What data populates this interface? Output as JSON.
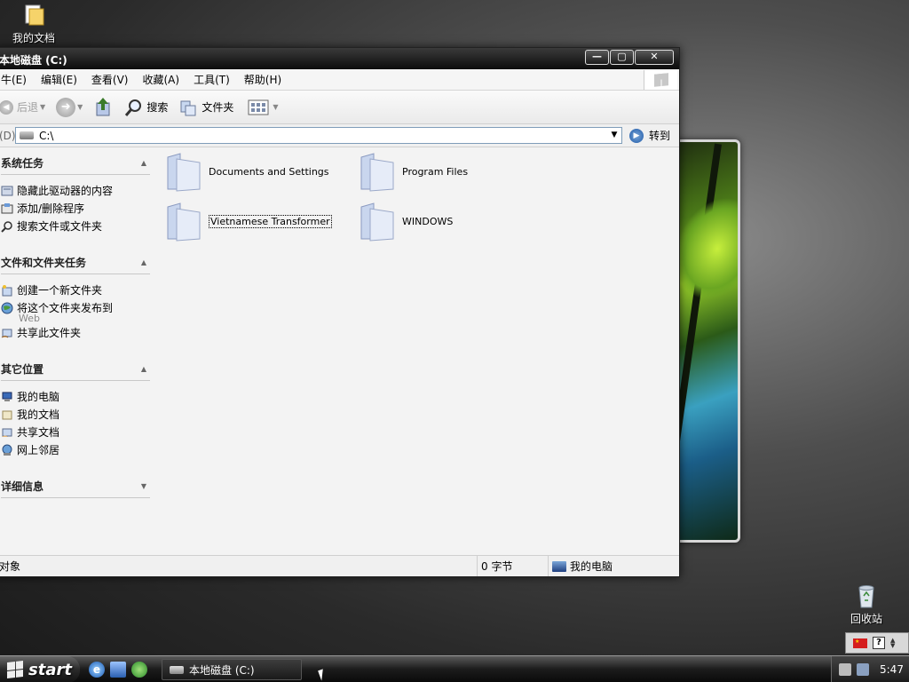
{
  "desktop": {
    "icons": [
      {
        "label": "我的文档"
      },
      {
        "label": "回收站"
      }
    ]
  },
  "window": {
    "title": "本地磁盘 (C:)",
    "buttons": {
      "minimize": "—",
      "maximize": "▢",
      "close": "✕"
    },
    "menu": [
      "文件(F)",
      "编辑(E)",
      "查看(V)",
      "收藏(A)",
      "工具(T)",
      "帮助(H)"
    ],
    "menu_visible": [
      "牛(E)",
      "编辑(E)",
      "查看(V)",
      "收藏(A)",
      "工具(T)",
      "帮助(H)"
    ],
    "toolbar": {
      "back": "后退",
      "search": "搜索",
      "folders": "文件夹"
    },
    "address": {
      "label": "(D)",
      "value": "C:\\",
      "go": "转到"
    },
    "taskpane": {
      "sections": [
        {
          "title": "系统任务",
          "items": [
            "隐藏此驱动器的内容",
            "添加/删除程序",
            "搜索文件或文件夹"
          ]
        },
        {
          "title": "文件和文件夹任务",
          "items": [
            "创建一个新文件夹",
            "将这个文件夹发布到",
            "共享此文件夹"
          ],
          "sub": "Web"
        },
        {
          "title": "其它位置",
          "items": [
            "我的电脑",
            "我的文档",
            "共享文档",
            "网上邻居"
          ]
        },
        {
          "title": "详细信息",
          "items": []
        }
      ]
    },
    "folders": [
      {
        "name": "Documents and Settings"
      },
      {
        "name": "Program Files"
      },
      {
        "name": "Vietnamese Transformer",
        "selected": true
      },
      {
        "name": "WINDOWS"
      }
    ],
    "status": {
      "left": "对象",
      "size": "0 字节",
      "location": "我的电脑"
    }
  },
  "taskbar": {
    "start": "start",
    "task_title": "本地磁盘 (C:)",
    "clock": "5:47"
  },
  "langbar": {
    "help": "?"
  }
}
